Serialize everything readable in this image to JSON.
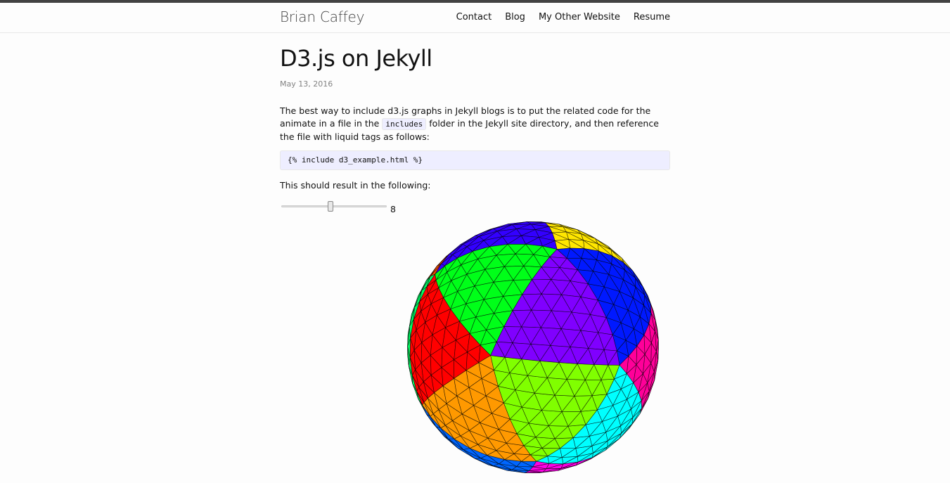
{
  "header": {
    "site_title": "Brian Caffey",
    "nav": [
      "Contact",
      "Blog",
      "My Other Website",
      "Resume"
    ]
  },
  "post": {
    "title": "D3.js on Jekyll",
    "date": "May 13, 2016",
    "para1_a": "The best way to include d3.js graphs in Jekyll blogs is to put the related code for the animate in a file in the ",
    "para1_code": "includes",
    "para1_b": " folder in the Jekyll site directory, and then reference the file with liquid tags as follows:",
    "code_block": "{% include d3_example.html %}",
    "para2": "This should result in the following:"
  },
  "slider": {
    "value": "8",
    "min": 1,
    "max": 16
  },
  "colors": {
    "accent_bar": "#424242",
    "code_bg": "#eeeeff"
  }
}
